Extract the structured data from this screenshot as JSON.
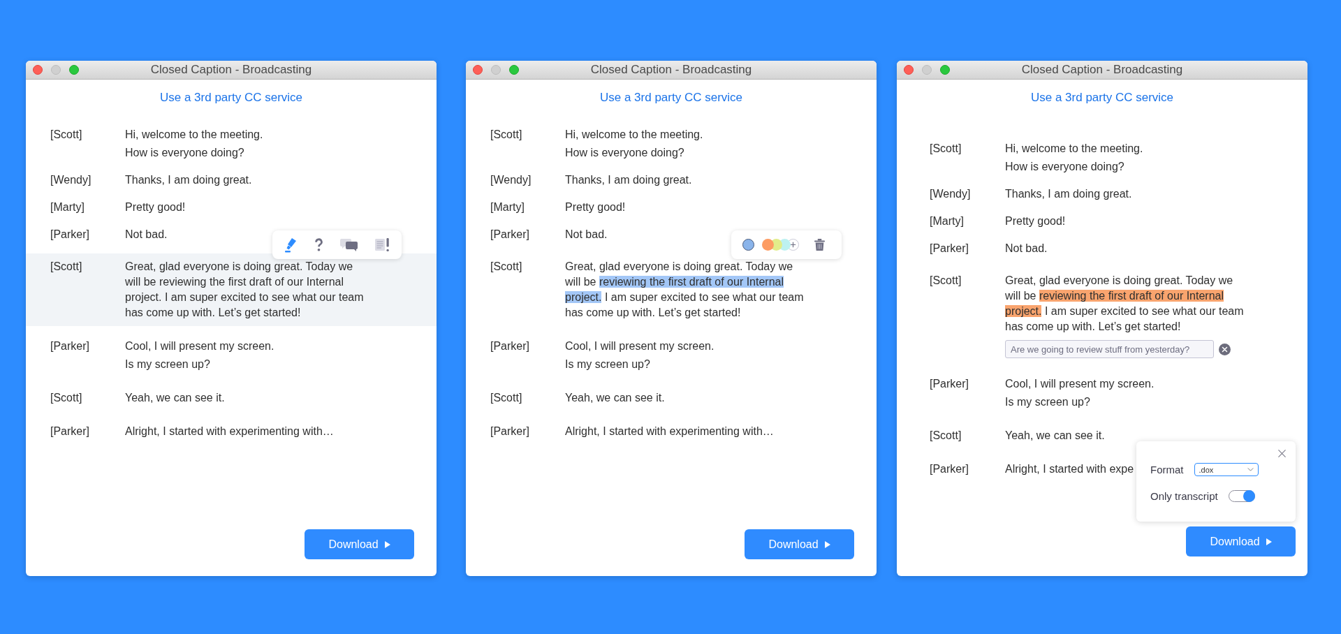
{
  "windows": [
    {
      "title": "Closed Caption - Broadcasting",
      "link": "Use a 3rd party CC service",
      "transcript": [
        {
          "speaker": "[Scott]",
          "selected": false,
          "messages": [
            [
              {
                "text": "Hi, welcome to the meeting.",
                "highlighted": false
              }
            ],
            [
              {
                "text": "How is everyone doing?",
                "highlighted": false
              }
            ]
          ]
        },
        {
          "speaker": "[Wendy]",
          "selected": false,
          "messages": [
            [
              {
                "text": "Thanks, I am doing great.",
                "highlighted": false
              }
            ]
          ]
        },
        {
          "speaker": "[Marty]",
          "selected": false,
          "messages": [
            [
              {
                "text": "Pretty good!",
                "highlighted": false
              }
            ]
          ]
        },
        {
          "speaker": "[Parker]",
          "selected": false,
          "messages": [
            [
              {
                "text": "Not bad.",
                "highlighted": false
              }
            ]
          ]
        },
        {
          "speaker": "[Scott]",
          "selected": true,
          "messages": [
            [
              {
                "text": "Great, glad everyone is doing great. Today we will be reviewing the first draft of our Internal project. I am super excited to see what our team has come up with. Let’s get started!",
                "highlighted": false
              }
            ]
          ],
          "toolbar": {
            "items": [
              {
                "kind": "highlighter",
                "selected": true
              },
              {
                "kind": "question",
                "selected": false
              },
              {
                "kind": "comments",
                "selected": false
              },
              {
                "kind": "flag",
                "selected": false
              }
            ]
          }
        },
        {
          "speaker": "[Parker]",
          "selected": false,
          "messages": [
            [
              {
                "text": "Cool, I will present my screen.",
                "highlighted": false
              }
            ],
            [
              {
                "text": "Is my screen up?",
                "highlighted": false
              }
            ]
          ]
        },
        {
          "speaker": "[Scott]",
          "selected": false,
          "messages": [
            [
              {
                "text": "Yeah, we can see it.",
                "highlighted": false
              }
            ]
          ]
        },
        {
          "speaker": "[Parker]",
          "selected": false,
          "messages": [
            [
              {
                "text": "Alright, I started with experimenting with…",
                "highlighted": false
              }
            ]
          ]
        }
      ],
      "download_button": {
        "label": "Download"
      }
    },
    {
      "title": "Closed Caption - Broadcasting",
      "link": "Use a 3rd party CC service",
      "transcript": [
        {
          "speaker": "[Scott]",
          "selected": false,
          "messages": [
            [
              {
                "text": "Hi, welcome to the meeting.",
                "highlighted": false
              }
            ],
            [
              {
                "text": "How is everyone doing?",
                "highlighted": false
              }
            ]
          ]
        },
        {
          "speaker": "[Wendy]",
          "selected": false,
          "messages": [
            [
              {
                "text": "Thanks, I am doing great.",
                "highlighted": false
              }
            ]
          ]
        },
        {
          "speaker": "[Marty]",
          "selected": false,
          "messages": [
            [
              {
                "text": "Pretty good!",
                "highlighted": false
              }
            ]
          ]
        },
        {
          "speaker": "[Parker]",
          "selected": false,
          "messages": [
            [
              {
                "text": "Not bad.",
                "highlighted": false
              }
            ]
          ]
        },
        {
          "speaker": "[Scott]",
          "selected": false,
          "messages": [
            [
              {
                "text": "Great, glad everyone is doing great. Today we will be ",
                "highlighted": false
              },
              {
                "text": "reviewing the first draft of our Internal project.",
                "highlighted": true,
                "color": "#a3c7f7"
              },
              {
                "text": " I am super excited to see what our team has come up with. Let’s get started!",
                "highlighted": false
              }
            ]
          ],
          "toolbar": {
            "items": [
              {
                "kind": "swatch",
                "color": "#8ab4ea",
                "selected": true
              },
              {
                "kind": "swatch",
                "color": "#fd9c63",
                "selected": false
              },
              {
                "kind": "swatch",
                "color": "#e2ed8a",
                "selected": false
              },
              {
                "kind": "swatch",
                "color": "#bdf1f1",
                "selected": false
              },
              {
                "kind": "add"
              },
              {
                "kind": "delete"
              }
            ]
          }
        },
        {
          "speaker": "[Parker]",
          "selected": false,
          "messages": [
            [
              {
                "text": "Cool, I will present my screen.",
                "highlighted": false
              }
            ],
            [
              {
                "text": "Is my screen up?",
                "highlighted": false
              }
            ]
          ]
        },
        {
          "speaker": "[Scott]",
          "selected": false,
          "messages": [
            [
              {
                "text": "Yeah, we can see it.",
                "highlighted": false
              }
            ]
          ]
        },
        {
          "speaker": "[Parker]",
          "selected": false,
          "messages": [
            [
              {
                "text": "Alright, I started with experimenting with…",
                "highlighted": false
              }
            ]
          ]
        }
      ],
      "download_button": {
        "label": "Download"
      }
    },
    {
      "title": "Closed Caption - Broadcasting",
      "link": "Use a 3rd party CC service",
      "transcript": [
        {
          "speaker": "[Scott]",
          "selected": false,
          "messages": [
            [
              {
                "text": "Hi, welcome to the meeting.",
                "highlighted": false
              }
            ],
            [
              {
                "text": "How is everyone doing?",
                "highlighted": false
              }
            ]
          ]
        },
        {
          "speaker": "[Wendy]",
          "selected": false,
          "messages": [
            [
              {
                "text": "Thanks, I am doing great.",
                "highlighted": false
              }
            ]
          ]
        },
        {
          "speaker": "[Marty]",
          "selected": false,
          "messages": [
            [
              {
                "text": "Pretty good!",
                "highlighted": false
              }
            ]
          ]
        },
        {
          "speaker": "[Parker]",
          "selected": false,
          "messages": [
            [
              {
                "text": "Not bad.",
                "highlighted": false
              }
            ]
          ]
        },
        {
          "speaker": "[Scott]",
          "selected": false,
          "messages": [
            [
              {
                "text": "Great, glad everyone is doing great. Today we will be ",
                "highlighted": false
              },
              {
                "text": "reviewing the first draft of our Internal project.",
                "highlighted": true,
                "color": "#f9a46e"
              },
              {
                "text": " I am super excited to see what our team has come up with. Let’s get started!",
                "highlighted": false
              }
            ]
          ],
          "comment": {
            "value": "Are we going to review stuff from yesterday?"
          }
        },
        {
          "speaker": "[Parker]",
          "selected": false,
          "messages": [
            [
              {
                "text": "Cool, I will present my screen.",
                "highlighted": false
              }
            ],
            [
              {
                "text": "Is my screen up?",
                "highlighted": false
              }
            ]
          ]
        },
        {
          "speaker": "[Scott]",
          "selected": false,
          "messages": [
            [
              {
                "text": "Yeah, we can see it.",
                "highlighted": false
              }
            ]
          ]
        },
        {
          "speaker": "[Parker]",
          "selected": false,
          "messages": [
            [
              {
                "text": "Alright, I started with expe",
                "highlighted": false
              }
            ]
          ]
        }
      ],
      "export_popover": {
        "fields": [
          {
            "kind": "select",
            "label": "Format",
            "value": ".dox"
          },
          {
            "kind": "toggle",
            "label": "Only transcript",
            "on": true
          }
        ]
      },
      "download_button": {
        "label": "Download"
      }
    }
  ]
}
